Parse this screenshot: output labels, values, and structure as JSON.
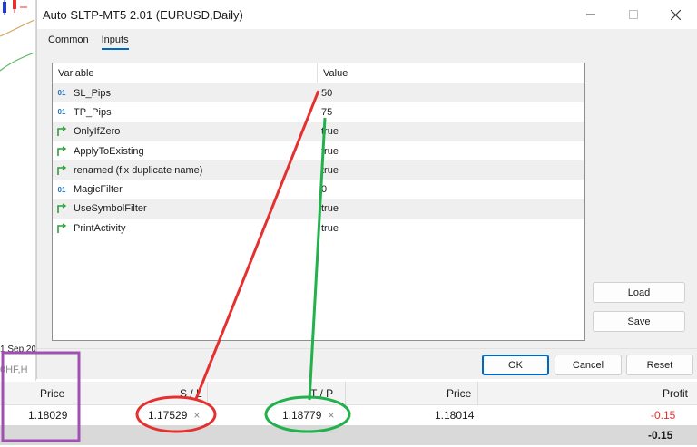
{
  "dialog": {
    "title": "Auto SLTP-MT5 2.01 (EURUSD,Daily)",
    "tabs": [
      {
        "label": "Common",
        "active": false
      },
      {
        "label": "Inputs",
        "active": true
      }
    ],
    "grid": {
      "columns": {
        "variable": "Variable",
        "value": "Value"
      },
      "rows": [
        {
          "icon": "int-icon",
          "icon_text": "01",
          "name": "SL_Pips",
          "value": "50"
        },
        {
          "icon": "int-icon",
          "icon_text": "01",
          "name": "TP_Pips",
          "value": "75"
        },
        {
          "icon": "bool-icon",
          "name": "OnlyIfZero",
          "value": "true"
        },
        {
          "icon": "bool-icon",
          "name": "ApplyToExisting",
          "value": "true"
        },
        {
          "icon": "bool-icon",
          "name": "renamed (fix duplicate name)",
          "value": "true"
        },
        {
          "icon": "int-icon",
          "icon_text": "01",
          "name": "MagicFilter",
          "value": "0"
        },
        {
          "icon": "bool-icon",
          "name": "UseSymbolFilter",
          "value": "true"
        },
        {
          "icon": "bool-icon",
          "name": "PrintActivity",
          "value": "true"
        }
      ]
    },
    "buttons": {
      "load": "Load",
      "save": "Save",
      "ok": "OK",
      "cancel": "Cancel",
      "reset": "Reset"
    }
  },
  "chart": {
    "date_label": "1 Sep 20"
  },
  "strip_text": "0HF,H",
  "terminal": {
    "headers": {
      "price": "Price",
      "sl": "S / L",
      "tp": "T / P",
      "price2": "Price",
      "profit": "Profit"
    },
    "row": {
      "price": "1.18029",
      "sl": "1.17529",
      "tp": "1.18779",
      "price2": "1.18014",
      "profit": "-0.15"
    },
    "total": {
      "profit": "-0.15"
    }
  },
  "colors": {
    "accent": "#0067c0",
    "annotation_red": "#e4312f",
    "annotation_green": "#22b14c",
    "annotation_purple": "#a24fb3",
    "negative": "#e4312f"
  }
}
